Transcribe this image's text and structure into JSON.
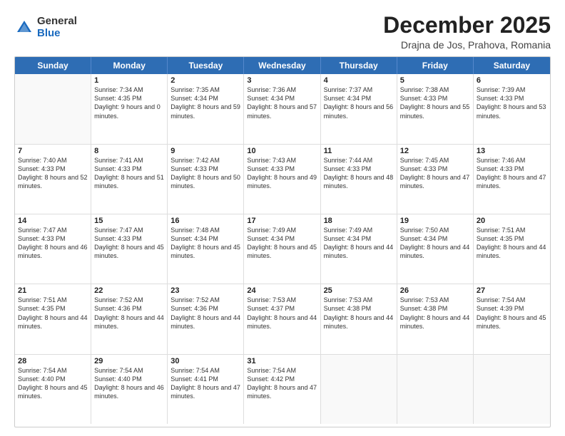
{
  "logo": {
    "general": "General",
    "blue": "Blue"
  },
  "title": "December 2025",
  "subtitle": "Drajna de Jos, Prahova, Romania",
  "header_days": [
    "Sunday",
    "Monday",
    "Tuesday",
    "Wednesday",
    "Thursday",
    "Friday",
    "Saturday"
  ],
  "weeks": [
    [
      {
        "day": "",
        "sunrise": "",
        "sunset": "",
        "daylight": ""
      },
      {
        "day": "1",
        "sunrise": "Sunrise: 7:34 AM",
        "sunset": "Sunset: 4:35 PM",
        "daylight": "Daylight: 9 hours and 0 minutes."
      },
      {
        "day": "2",
        "sunrise": "Sunrise: 7:35 AM",
        "sunset": "Sunset: 4:34 PM",
        "daylight": "Daylight: 8 hours and 59 minutes."
      },
      {
        "day": "3",
        "sunrise": "Sunrise: 7:36 AM",
        "sunset": "Sunset: 4:34 PM",
        "daylight": "Daylight: 8 hours and 57 minutes."
      },
      {
        "day": "4",
        "sunrise": "Sunrise: 7:37 AM",
        "sunset": "Sunset: 4:34 PM",
        "daylight": "Daylight: 8 hours and 56 minutes."
      },
      {
        "day": "5",
        "sunrise": "Sunrise: 7:38 AM",
        "sunset": "Sunset: 4:33 PM",
        "daylight": "Daylight: 8 hours and 55 minutes."
      },
      {
        "day": "6",
        "sunrise": "Sunrise: 7:39 AM",
        "sunset": "Sunset: 4:33 PM",
        "daylight": "Daylight: 8 hours and 53 minutes."
      }
    ],
    [
      {
        "day": "7",
        "sunrise": "Sunrise: 7:40 AM",
        "sunset": "Sunset: 4:33 PM",
        "daylight": "Daylight: 8 hours and 52 minutes."
      },
      {
        "day": "8",
        "sunrise": "Sunrise: 7:41 AM",
        "sunset": "Sunset: 4:33 PM",
        "daylight": "Daylight: 8 hours and 51 minutes."
      },
      {
        "day": "9",
        "sunrise": "Sunrise: 7:42 AM",
        "sunset": "Sunset: 4:33 PM",
        "daylight": "Daylight: 8 hours and 50 minutes."
      },
      {
        "day": "10",
        "sunrise": "Sunrise: 7:43 AM",
        "sunset": "Sunset: 4:33 PM",
        "daylight": "Daylight: 8 hours and 49 minutes."
      },
      {
        "day": "11",
        "sunrise": "Sunrise: 7:44 AM",
        "sunset": "Sunset: 4:33 PM",
        "daylight": "Daylight: 8 hours and 48 minutes."
      },
      {
        "day": "12",
        "sunrise": "Sunrise: 7:45 AM",
        "sunset": "Sunset: 4:33 PM",
        "daylight": "Daylight: 8 hours and 47 minutes."
      },
      {
        "day": "13",
        "sunrise": "Sunrise: 7:46 AM",
        "sunset": "Sunset: 4:33 PM",
        "daylight": "Daylight: 8 hours and 47 minutes."
      }
    ],
    [
      {
        "day": "14",
        "sunrise": "Sunrise: 7:47 AM",
        "sunset": "Sunset: 4:33 PM",
        "daylight": "Daylight: 8 hours and 46 minutes."
      },
      {
        "day": "15",
        "sunrise": "Sunrise: 7:47 AM",
        "sunset": "Sunset: 4:33 PM",
        "daylight": "Daylight: 8 hours and 45 minutes."
      },
      {
        "day": "16",
        "sunrise": "Sunrise: 7:48 AM",
        "sunset": "Sunset: 4:34 PM",
        "daylight": "Daylight: 8 hours and 45 minutes."
      },
      {
        "day": "17",
        "sunrise": "Sunrise: 7:49 AM",
        "sunset": "Sunset: 4:34 PM",
        "daylight": "Daylight: 8 hours and 45 minutes."
      },
      {
        "day": "18",
        "sunrise": "Sunrise: 7:49 AM",
        "sunset": "Sunset: 4:34 PM",
        "daylight": "Daylight: 8 hours and 44 minutes."
      },
      {
        "day": "19",
        "sunrise": "Sunrise: 7:50 AM",
        "sunset": "Sunset: 4:34 PM",
        "daylight": "Daylight: 8 hours and 44 minutes."
      },
      {
        "day": "20",
        "sunrise": "Sunrise: 7:51 AM",
        "sunset": "Sunset: 4:35 PM",
        "daylight": "Daylight: 8 hours and 44 minutes."
      }
    ],
    [
      {
        "day": "21",
        "sunrise": "Sunrise: 7:51 AM",
        "sunset": "Sunset: 4:35 PM",
        "daylight": "Daylight: 8 hours and 44 minutes."
      },
      {
        "day": "22",
        "sunrise": "Sunrise: 7:52 AM",
        "sunset": "Sunset: 4:36 PM",
        "daylight": "Daylight: 8 hours and 44 minutes."
      },
      {
        "day": "23",
        "sunrise": "Sunrise: 7:52 AM",
        "sunset": "Sunset: 4:36 PM",
        "daylight": "Daylight: 8 hours and 44 minutes."
      },
      {
        "day": "24",
        "sunrise": "Sunrise: 7:53 AM",
        "sunset": "Sunset: 4:37 PM",
        "daylight": "Daylight: 8 hours and 44 minutes."
      },
      {
        "day": "25",
        "sunrise": "Sunrise: 7:53 AM",
        "sunset": "Sunset: 4:38 PM",
        "daylight": "Daylight: 8 hours and 44 minutes."
      },
      {
        "day": "26",
        "sunrise": "Sunrise: 7:53 AM",
        "sunset": "Sunset: 4:38 PM",
        "daylight": "Daylight: 8 hours and 44 minutes."
      },
      {
        "day": "27",
        "sunrise": "Sunrise: 7:54 AM",
        "sunset": "Sunset: 4:39 PM",
        "daylight": "Daylight: 8 hours and 45 minutes."
      }
    ],
    [
      {
        "day": "28",
        "sunrise": "Sunrise: 7:54 AM",
        "sunset": "Sunset: 4:40 PM",
        "daylight": "Daylight: 8 hours and 45 minutes."
      },
      {
        "day": "29",
        "sunrise": "Sunrise: 7:54 AM",
        "sunset": "Sunset: 4:40 PM",
        "daylight": "Daylight: 8 hours and 46 minutes."
      },
      {
        "day": "30",
        "sunrise": "Sunrise: 7:54 AM",
        "sunset": "Sunset: 4:41 PM",
        "daylight": "Daylight: 8 hours and 47 minutes."
      },
      {
        "day": "31",
        "sunrise": "Sunrise: 7:54 AM",
        "sunset": "Sunset: 4:42 PM",
        "daylight": "Daylight: 8 hours and 47 minutes."
      },
      {
        "day": "",
        "sunrise": "",
        "sunset": "",
        "daylight": ""
      },
      {
        "day": "",
        "sunrise": "",
        "sunset": "",
        "daylight": ""
      },
      {
        "day": "",
        "sunrise": "",
        "sunset": "",
        "daylight": ""
      }
    ]
  ]
}
